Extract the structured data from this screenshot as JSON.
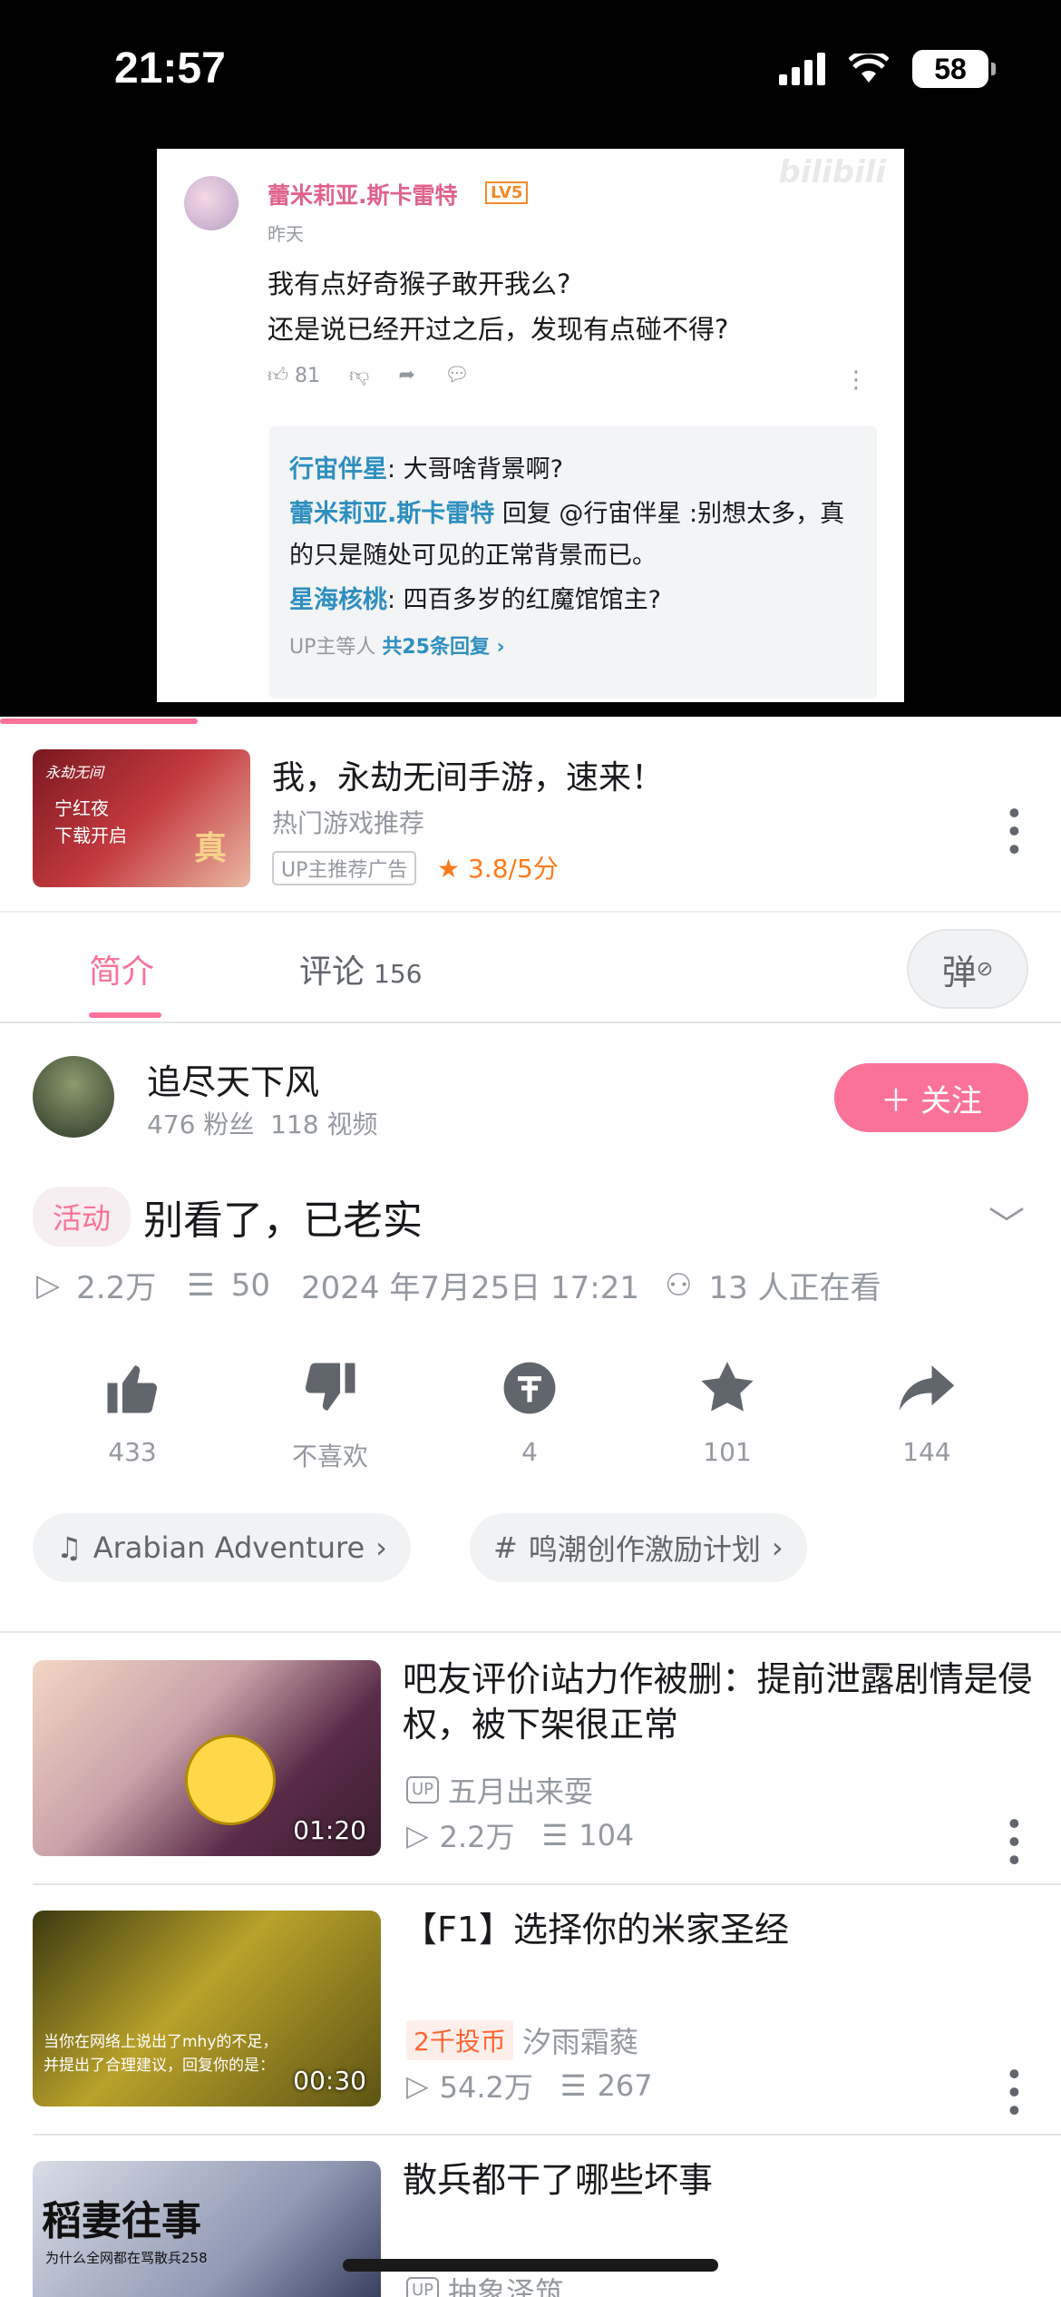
{
  "status_bar": {
    "time": "21:57",
    "battery": "58"
  },
  "comment_frame": {
    "username": "蕾米莉亚.斯卡雷特",
    "level": "LV5",
    "date": "昨天",
    "line1": "我有点好奇猴子敢开我么?",
    "line2": "还是说已经开过之后，发现有点碰不得?",
    "likes": "81",
    "replies": [
      {
        "name": "行宙伴星",
        "text": ": 大哥啥背景啊?"
      },
      {
        "name": "蕾米莉亚.斯卡雷特",
        "text": " 回复 @行宙伴星 :别想太多，真的只是随处可见的正常背景而已。"
      },
      {
        "name": "星海核桃",
        "text": ": 四百多岁的红魔馆馆主?"
      }
    ],
    "reply_more_prefix": "UP主等人 ",
    "reply_more_link": "共25条回复 ›"
  },
  "ad": {
    "thumb_brand": "永劫无间",
    "thumb_line1": "宁红夜",
    "thumb_line2": "下载开启",
    "thumb_big": "真",
    "title": "我，永劫无间手游，速来！",
    "subtitle": "热门游戏推荐",
    "tag": "UP主推荐广告",
    "rating": "3.8/5分"
  },
  "tabs": {
    "intro": "简介",
    "comments": "评论",
    "comments_count": "156",
    "danmaku_icon": "弹"
  },
  "uploader": {
    "name": "追尽天下风",
    "fans": "476 粉丝",
    "videos": "118 视频",
    "follow": "关注"
  },
  "video": {
    "activity_tag": "活动",
    "title": "别看了，已老实",
    "views": "2.2万",
    "danmaku": "50",
    "date": "2024 年7月25日 17:21",
    "watching": "13 人正在看"
  },
  "actions": {
    "like": "433",
    "dislike": "不喜欢",
    "coin": "4",
    "favorite": "101",
    "share": "144"
  },
  "chips": {
    "music": "Arabian Adventure",
    "topic": "鸣潮创作激励计划"
  },
  "recommendations": [
    {
      "title": "吧友评价i站力作被删：提前泄露剧情是侵权，被下架很正常",
      "duration": "01:20",
      "author": "五月出来耍",
      "views": "2.2万",
      "danmaku": "104",
      "coin_tag": ""
    },
    {
      "title": "【F1】选择你的米家圣经",
      "duration": "00:30",
      "author": "汐雨霜蕤",
      "views": "54.2万",
      "danmaku": "267",
      "coin_tag": "2千投币",
      "thumb_caption": "当你在网络上说出了mhy的不足，并提出了合理建议，回复你的是："
    },
    {
      "title": "散兵都干了哪些坏事",
      "duration": "",
      "author": "抽象泽筑",
      "views": "",
      "danmaku": "",
      "coin_tag": "",
      "thumb_caption": "稻妻往事",
      "thumb_sub": "为什么全网都在骂散兵258"
    }
  ]
}
